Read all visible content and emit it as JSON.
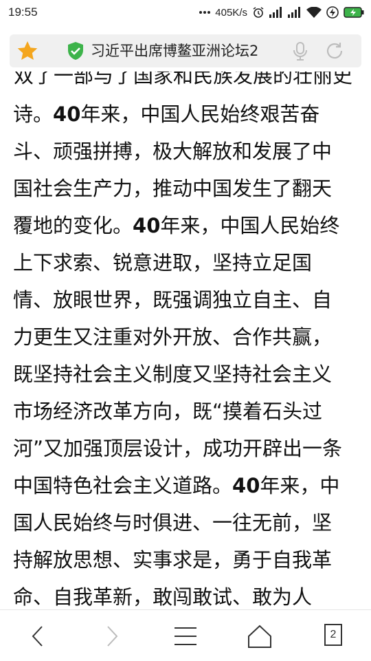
{
  "status_bar": {
    "time": "19:55",
    "network_speed": "405K/s",
    "icons": [
      "more-dots-icon",
      "alarm-icon",
      "signal-icon",
      "signal-icon",
      "wifi-icon",
      "charging-icon",
      "battery-icon"
    ]
  },
  "address_bar": {
    "title": "习近平出席博鳌亚洲论坛2",
    "icons": [
      "star-icon",
      "shield-check-icon",
      "microphone-icon",
      "reload-icon"
    ]
  },
  "article": {
    "cut_top_line": "双了一部与了国家和民族发展的壮丽史",
    "lines": [
      [
        {
          "t": "诗。",
          "b": false
        },
        {
          "t": "40",
          "b": true
        },
        {
          "t": "年来，中国人民始终艰苦奋",
          "b": false
        }
      ],
      [
        {
          "t": "斗、顽强拼搏，极大解放和发展了中",
          "b": false
        }
      ],
      [
        {
          "t": "国社会生产力，推动中国发生了翻天",
          "b": false
        }
      ],
      [
        {
          "t": "覆地的变化。",
          "b": false
        },
        {
          "t": "40",
          "b": true
        },
        {
          "t": "年来，中国人民始终",
          "b": false
        }
      ],
      [
        {
          "t": "上下求索、锐意进取，坚持立足国",
          "b": false
        }
      ],
      [
        {
          "t": "情、放眼世界，既强调独立自主、自",
          "b": false
        }
      ],
      [
        {
          "t": "力更生又注重对外开放、合作共赢，",
          "b": false
        }
      ],
      [
        {
          "t": "既坚持社会主义制度又坚持社会主义",
          "b": false
        }
      ],
      [
        {
          "t": "市场经济改革方向，既“摸着石头过",
          "b": false
        }
      ],
      [
        {
          "t": "河”又加强顶层设计，成功开辟出一条",
          "b": false
        }
      ],
      [
        {
          "t": "中国特色社会主义道路。",
          "b": false
        },
        {
          "t": "40",
          "b": true
        },
        {
          "t": "年来，中",
          "b": false
        }
      ],
      [
        {
          "t": "国人民始终与时俱进、一往无前，坚",
          "b": false
        }
      ],
      [
        {
          "t": "持解放思想、实事求是，勇于自我革",
          "b": false
        }
      ],
      [
        {
          "t": "命、自我革新，敢闯敢试、敢为人",
          "b": false
        }
      ]
    ]
  },
  "bottom_bar": {
    "tab_count": "2",
    "icons": [
      "back-icon",
      "forward-icon",
      "menu-icon",
      "home-icon",
      "tabs-icon"
    ]
  },
  "colors": {
    "star": "#f4a61e",
    "shield": "#3db34a",
    "text": "#111111",
    "address_bar_bg": "#f0f0f0",
    "battery": "#3db34a"
  }
}
